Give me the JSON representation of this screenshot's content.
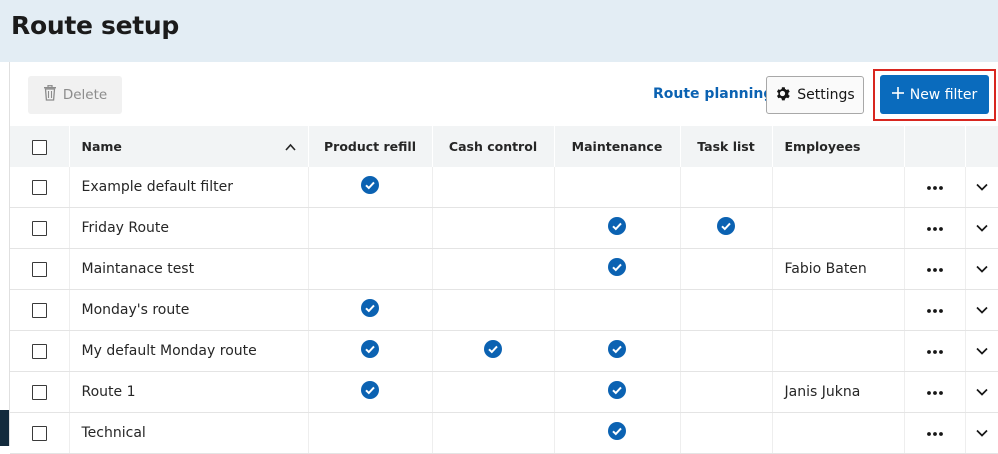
{
  "page": {
    "title": "Route setup"
  },
  "toolbar": {
    "delete_label": "Delete",
    "route_planning_label": "Route planning",
    "settings_label": "Settings",
    "new_filter_label": "New filter"
  },
  "icons": {
    "delete": "trash-icon",
    "settings": "gear-icon",
    "new_filter": "plus-icon",
    "sort": "chevron-up-icon",
    "row_menu": "more-dots-icon",
    "row_expand": "chevron-down-icon",
    "enabled": "check-circle-icon"
  },
  "colors": {
    "accent": "#0a6bbd",
    "highlight": "#d8261f",
    "check": "#0b62b2"
  },
  "table": {
    "columns": [
      "Name",
      "Product refill",
      "Cash control",
      "Maintenance",
      "Task list",
      "Employees"
    ],
    "rows": [
      {
        "name": "Example default filter",
        "product_refill": true,
        "cash_control": false,
        "maintenance": false,
        "task_list": false,
        "employees": ""
      },
      {
        "name": "Friday Route",
        "product_refill": false,
        "cash_control": false,
        "maintenance": true,
        "task_list": true,
        "employees": ""
      },
      {
        "name": "Maintanace test",
        "product_refill": false,
        "cash_control": false,
        "maintenance": true,
        "task_list": false,
        "employees": "Fabio Baten"
      },
      {
        "name": "Monday's route",
        "product_refill": true,
        "cash_control": false,
        "maintenance": false,
        "task_list": false,
        "employees": ""
      },
      {
        "name": "My default Monday route",
        "product_refill": true,
        "cash_control": true,
        "maintenance": true,
        "task_list": false,
        "employees": ""
      },
      {
        "name": "Route 1",
        "product_refill": true,
        "cash_control": false,
        "maintenance": true,
        "task_list": false,
        "employees": "Janis Jukna"
      },
      {
        "name": "Technical",
        "product_refill": false,
        "cash_control": false,
        "maintenance": true,
        "task_list": false,
        "employees": ""
      }
    ]
  }
}
